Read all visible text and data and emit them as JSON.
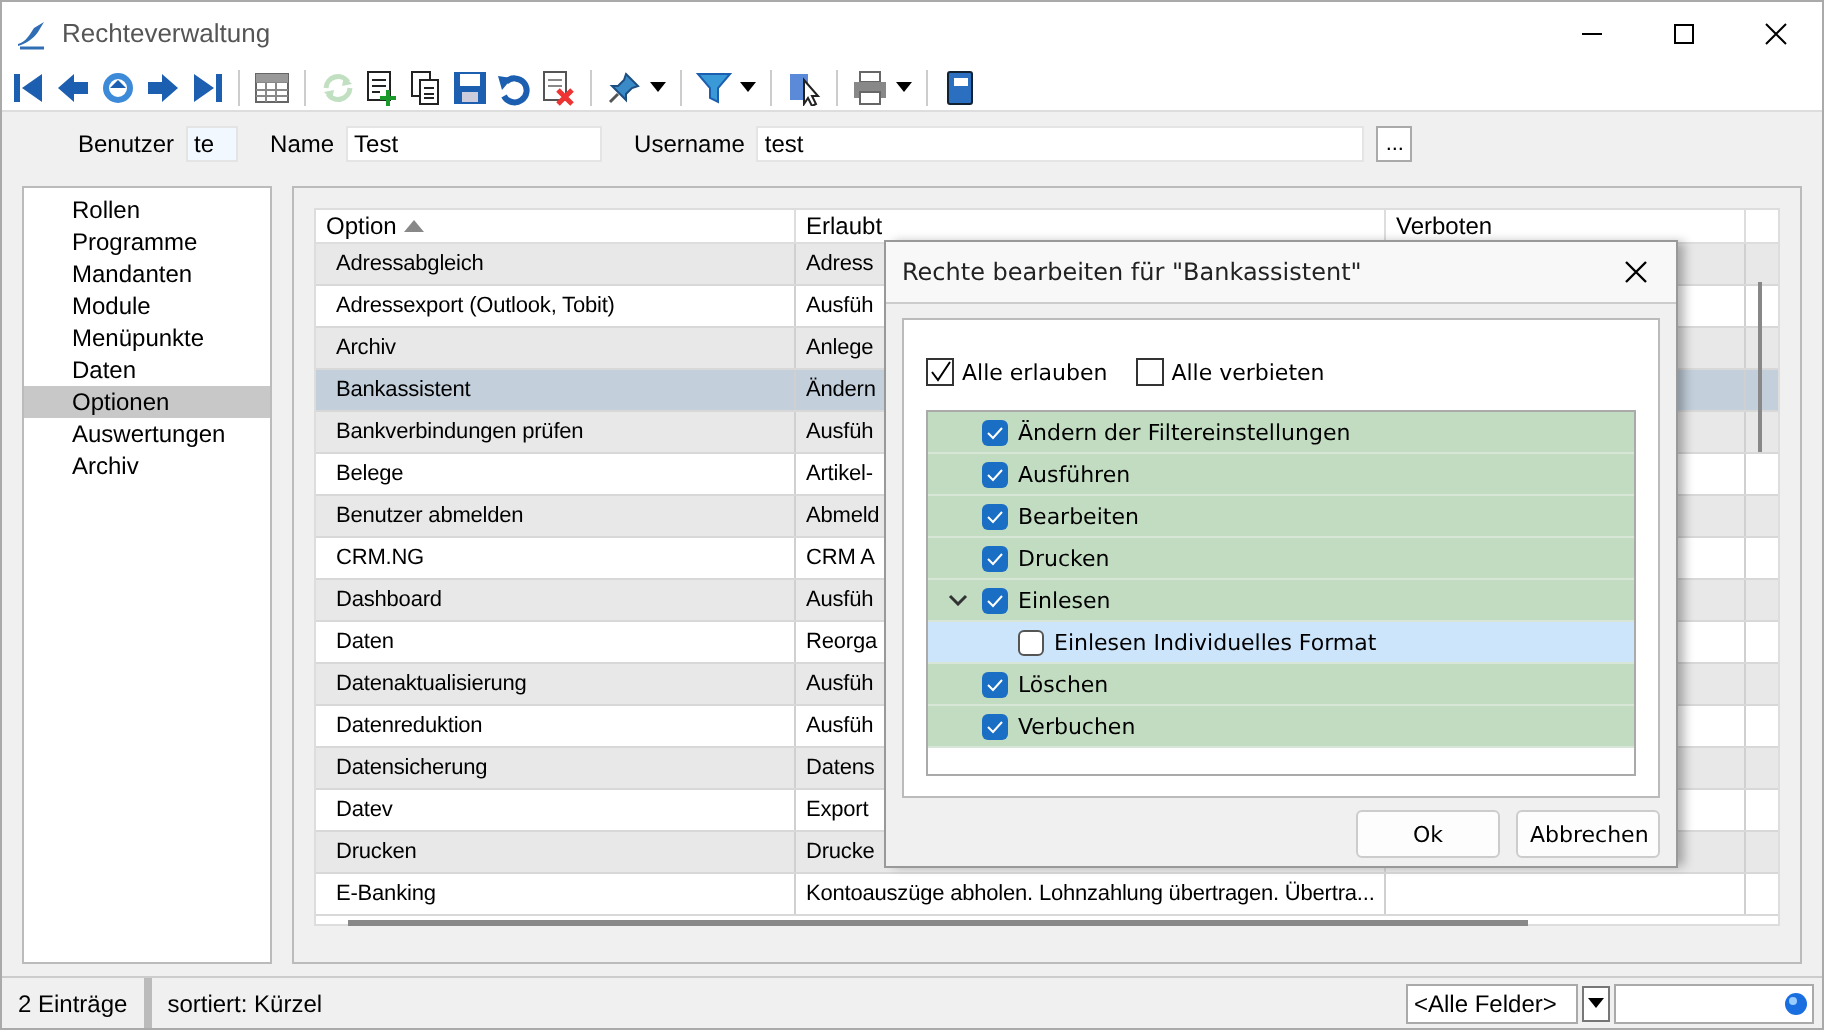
{
  "window": {
    "title": "Rechteverwaltung"
  },
  "toolbar": [
    {
      "kind": "first",
      "disabled": false
    },
    {
      "kind": "prev",
      "disabled": false
    },
    {
      "kind": "reload",
      "disabled": false
    },
    {
      "kind": "next",
      "disabled": false
    },
    {
      "kind": "last",
      "disabled": false
    },
    {
      "kind": "sep"
    },
    {
      "kind": "grid",
      "disabled": false
    },
    {
      "kind": "sep"
    },
    {
      "kind": "refresh",
      "disabled": true
    },
    {
      "kind": "new",
      "disabled": false
    },
    {
      "kind": "copy",
      "disabled": false
    },
    {
      "kind": "save",
      "disabled": false
    },
    {
      "kind": "undo",
      "disabled": false
    },
    {
      "kind": "delete",
      "disabled": false
    },
    {
      "kind": "sep"
    },
    {
      "kind": "pin",
      "disabled": false,
      "dropdown": true
    },
    {
      "kind": "sep"
    },
    {
      "kind": "filter",
      "disabled": false,
      "dropdown": true
    },
    {
      "kind": "sep"
    },
    {
      "kind": "select",
      "disabled": false
    },
    {
      "kind": "sep"
    },
    {
      "kind": "print",
      "disabled": false,
      "dropdown": true
    },
    {
      "kind": "sep"
    },
    {
      "kind": "book",
      "disabled": false
    }
  ],
  "form": {
    "fields": [
      {
        "label": "Benutzer",
        "value": "te",
        "kind": "short"
      },
      {
        "label": "Name",
        "value": "Test",
        "kind": "medium"
      },
      {
        "label": "Username",
        "value": "test",
        "kind": "long",
        "button": "..."
      }
    ]
  },
  "sidebar": {
    "items": [
      {
        "label": "Rollen",
        "selected": false
      },
      {
        "label": "Programme",
        "selected": false
      },
      {
        "label": "Mandanten",
        "selected": false
      },
      {
        "label": "Module",
        "selected": false
      },
      {
        "label": "Menüpunkte",
        "selected": false
      },
      {
        "label": "Daten",
        "selected": false
      },
      {
        "label": "Optionen",
        "selected": true
      },
      {
        "label": "Auswertungen",
        "selected": false
      },
      {
        "label": "Archiv",
        "selected": false
      }
    ]
  },
  "table": {
    "columns": [
      {
        "label": "Option",
        "sorted": true
      },
      {
        "label": "Erlaubt"
      },
      {
        "label": "Verboten"
      }
    ],
    "rows": [
      {
        "option": "Adressabgleich",
        "allowed": "Adress",
        "selected": false
      },
      {
        "option": "Adressexport (Outlook, Tobit)",
        "allowed": "Ausfüh",
        "selected": false
      },
      {
        "option": "Archiv",
        "allowed": "Anlege",
        "selected": false
      },
      {
        "option": "Bankassistent",
        "allowed": "Ändern",
        "selected": true
      },
      {
        "option": "Bankverbindungen prüfen",
        "allowed": "Ausfüh",
        "selected": false
      },
      {
        "option": "Belege",
        "allowed": "Artikel-",
        "selected": false
      },
      {
        "option": "Benutzer abmelden",
        "allowed": "Abmeld",
        "selected": false
      },
      {
        "option": "CRM.NG",
        "allowed": "CRM A",
        "selected": false
      },
      {
        "option": "Dashboard",
        "allowed": "Ausfüh",
        "selected": false
      },
      {
        "option": "Daten",
        "allowed": "Reorga",
        "selected": false
      },
      {
        "option": "Datenaktualisierung",
        "allowed": "Ausfüh",
        "selected": false
      },
      {
        "option": "Datenreduktion",
        "allowed": "Ausfüh",
        "selected": false
      },
      {
        "option": "Datensicherung",
        "allowed": "Datens",
        "selected": false
      },
      {
        "option": "Datev",
        "allowed": "Export",
        "selected": false
      },
      {
        "option": "Drucken",
        "allowed": "Drucke",
        "selected": false
      },
      {
        "option": "E-Banking",
        "allowed": "Kontoauszüge abholen. Lohnzahlung übertragen. Übertra...",
        "selected": false
      }
    ]
  },
  "dialog": {
    "title": "Rechte bearbeiten für \"Bankassistent\"",
    "all": [
      {
        "label": "Alle erlauben",
        "checked": true
      },
      {
        "label": "Alle verbieten",
        "checked": false
      }
    ],
    "tree": [
      {
        "label": "Ändern der Filtereinstellungen",
        "checked": true
      },
      {
        "label": "Ausführen",
        "checked": true
      },
      {
        "label": "Bearbeiten",
        "checked": true
      },
      {
        "label": "Drucken",
        "checked": true
      },
      {
        "label": "Einlesen",
        "checked": true,
        "expanded": true,
        "children": [
          {
            "label": "Einlesen Individuelles Format",
            "checked": false
          }
        ]
      },
      {
        "label": "Löschen",
        "checked": true
      },
      {
        "label": "Verbuchen",
        "checked": true
      }
    ],
    "buttons": [
      "Ok",
      "Abbrechen"
    ]
  },
  "status_bar": {
    "count": "2 Einträge",
    "sort": "sortiert: Kürzel",
    "field_filter": "<Alle Felder>"
  }
}
